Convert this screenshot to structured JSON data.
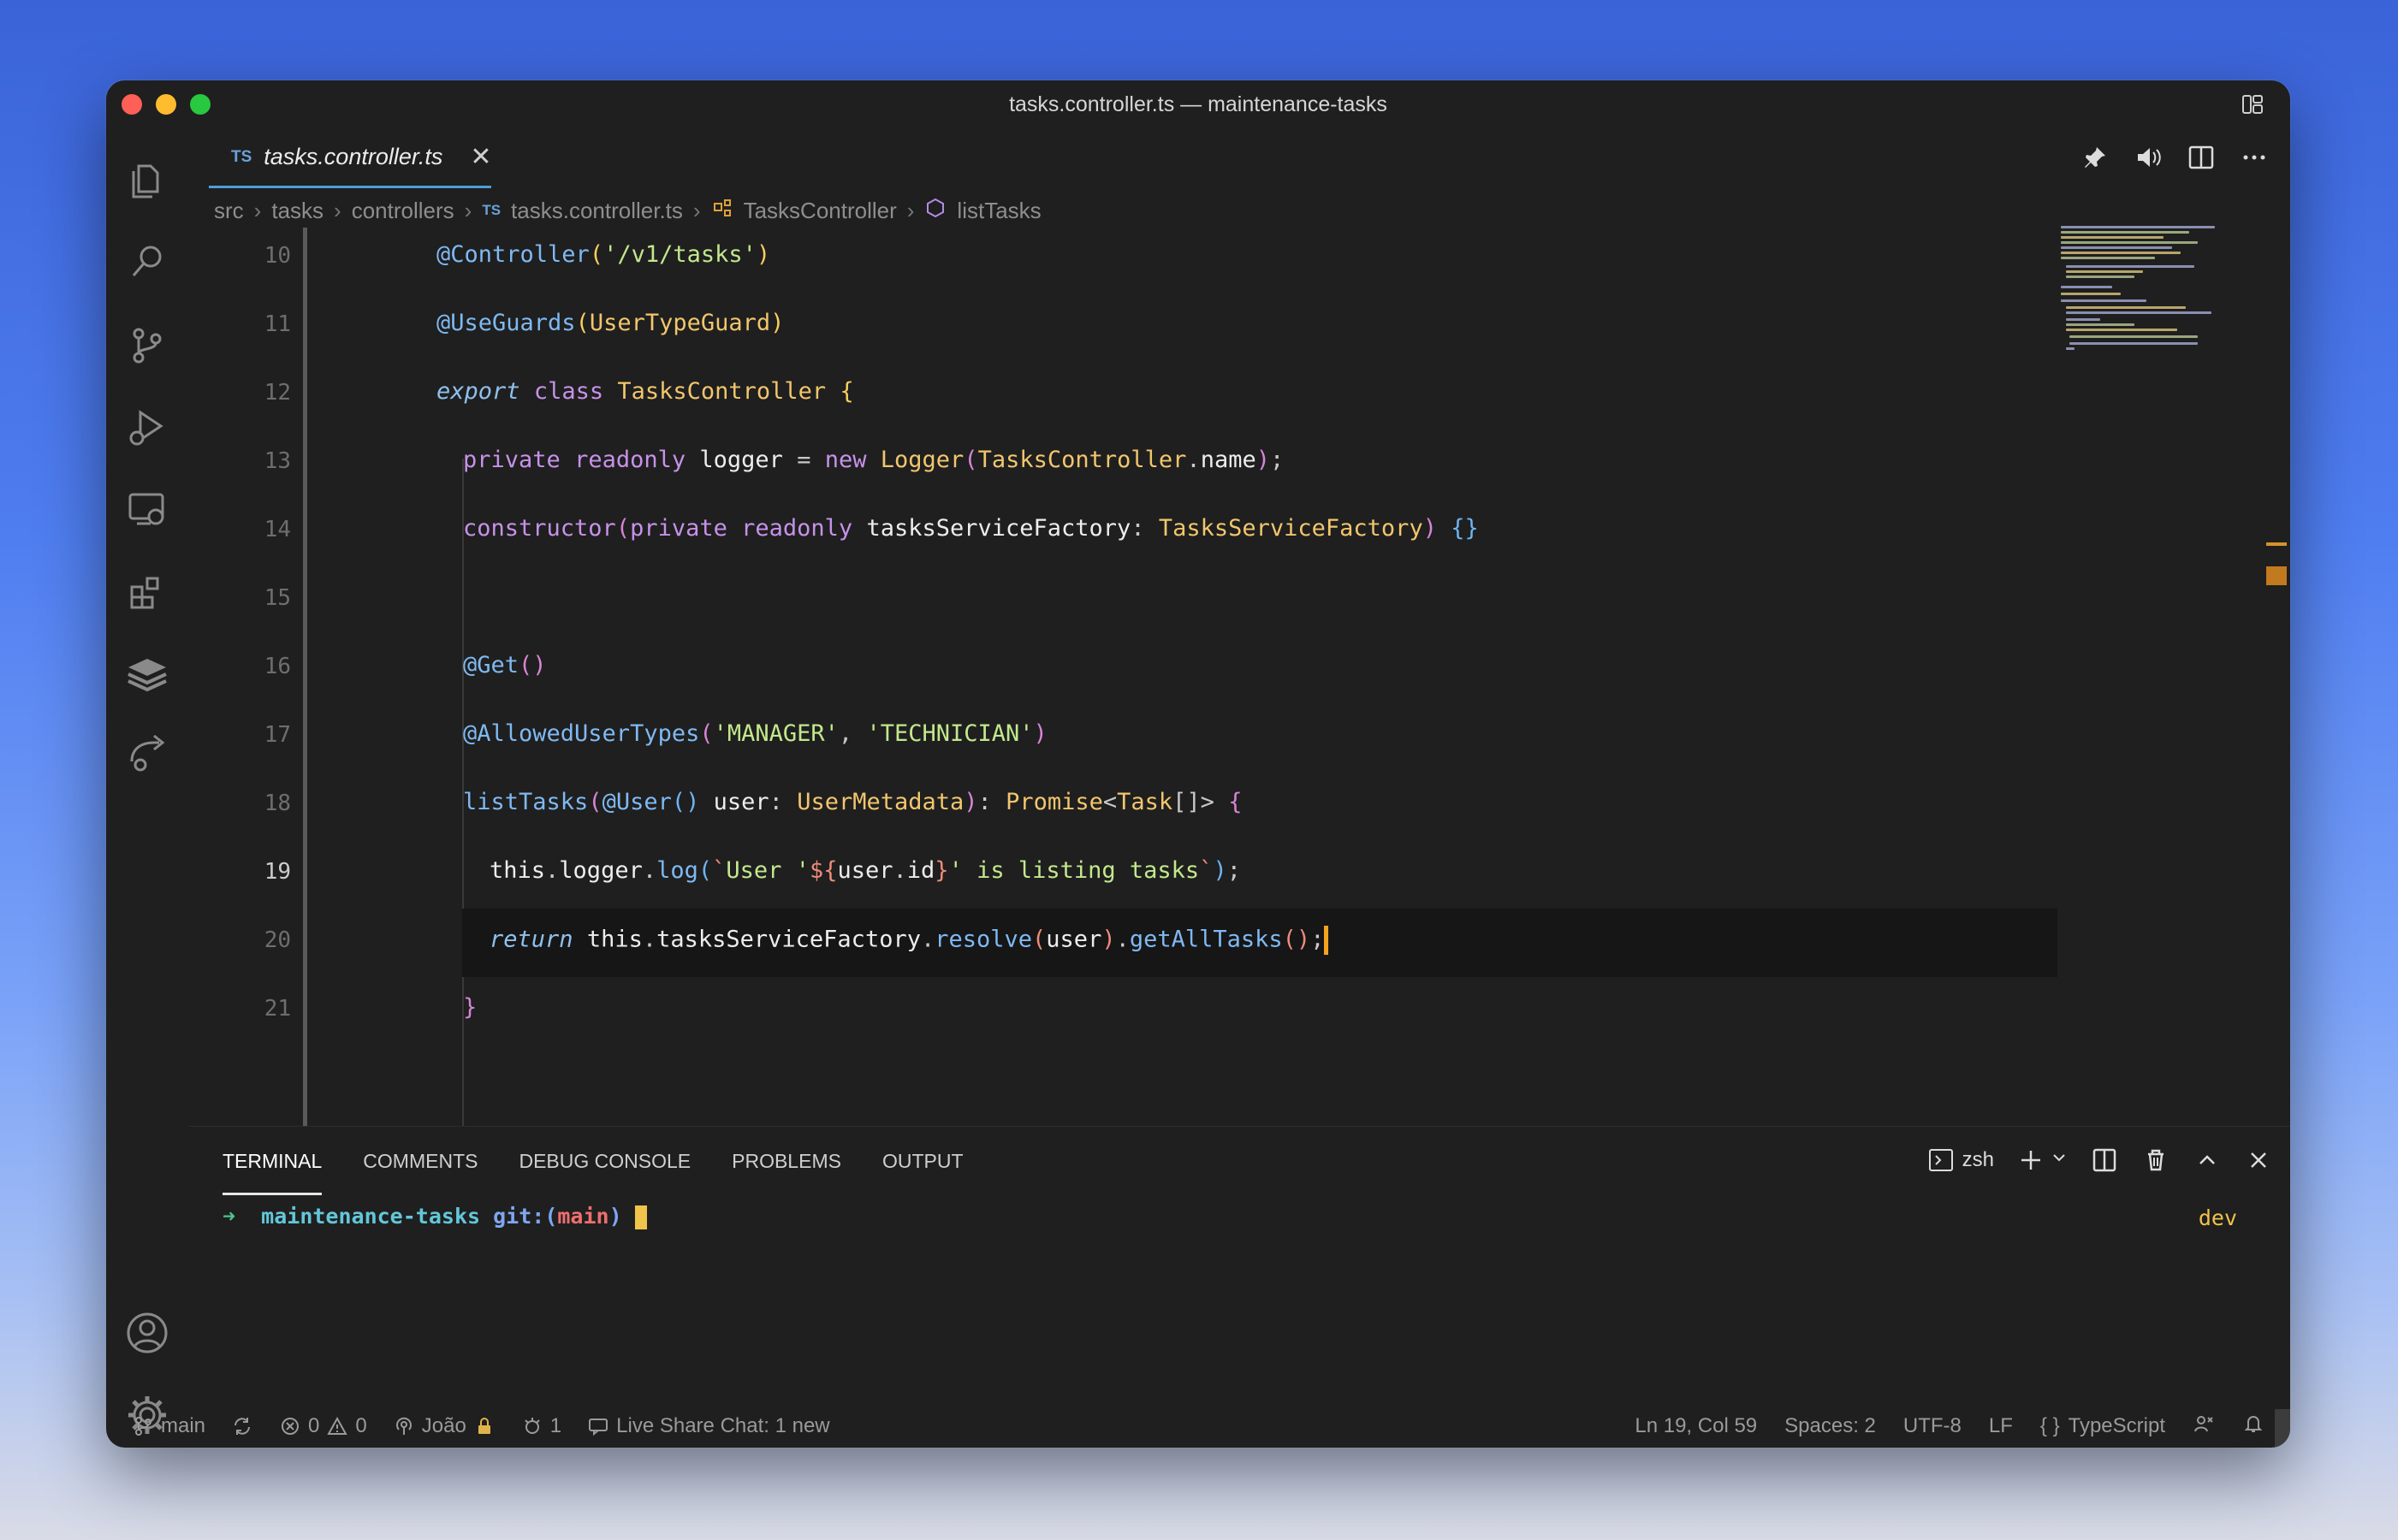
{
  "window": {
    "title": "tasks.controller.ts — maintenance-tasks"
  },
  "tab": {
    "lang_badge": "TS",
    "filename": "tasks.controller.ts",
    "close_glyph": "✕"
  },
  "breadcrumb": {
    "items": [
      "src",
      "tasks",
      "controllers",
      "tasks.controller.ts",
      "TasksController",
      "listTasks"
    ],
    "file_badge": "TS"
  },
  "editor": {
    "line_numbers": [
      "10",
      "11",
      "12",
      "13",
      "14",
      "15",
      "16",
      "17",
      "18",
      "19",
      "20",
      "21"
    ],
    "active_line": "19"
  },
  "panel": {
    "tabs": [
      "TERMINAL",
      "COMMENTS",
      "DEBUG CONSOLE",
      "PROBLEMS",
      "OUTPUT"
    ],
    "shell": "zsh",
    "terminal": {
      "arrow": "➜",
      "dir": "maintenance-tasks",
      "git_label": "git:(",
      "branch": "main",
      "git_close": ")",
      "right_label": "dev"
    }
  },
  "status": {
    "branch": "main",
    "errors": "0",
    "warnings": "0",
    "user": "João",
    "ports": "1",
    "live_share": "Live Share Chat: 1 new",
    "position": "Ln 19, Col 59",
    "spaces": "Spaces: 2",
    "encoding": "UTF-8",
    "eol": "LF",
    "language": "TypeScript"
  },
  "icons": {
    "activity": [
      "explorer-icon",
      "search-icon",
      "source-control-icon",
      "run-debug-icon",
      "remote-explorer-icon",
      "extensions-icon",
      "layers-icon",
      "live-share-icon",
      "account-icon",
      "settings-gear-icon"
    ]
  },
  "colors": {
    "accent": "#4d9fd8",
    "cursor": "#f3a41e"
  }
}
